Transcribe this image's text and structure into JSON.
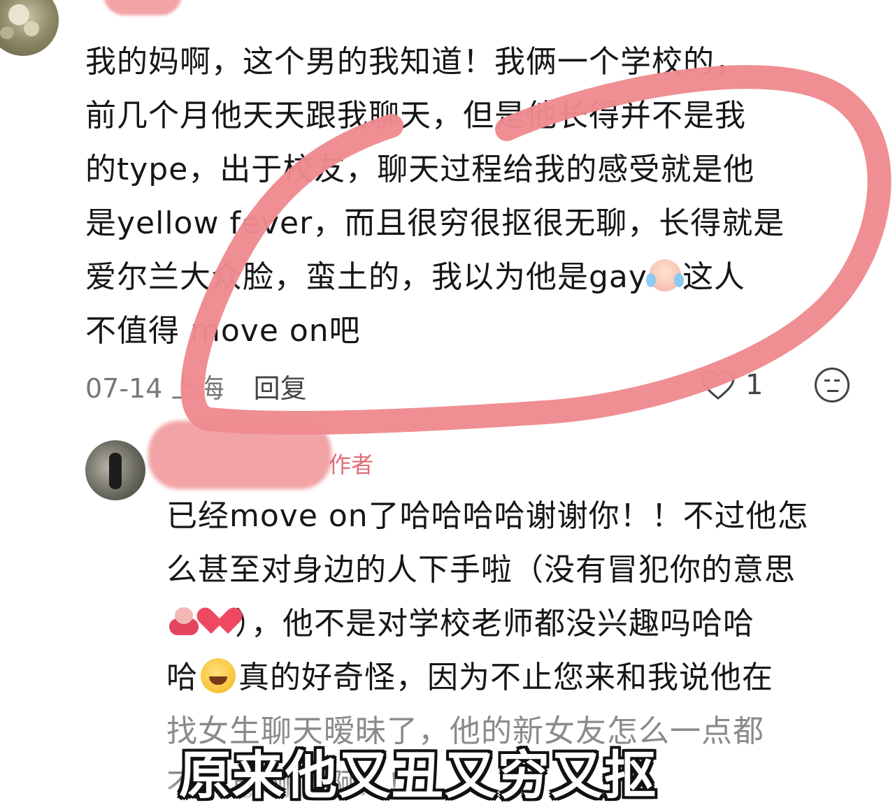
{
  "comment1": {
    "lines": [
      "我的妈啊，这个男的我知道！我俩一个学校的，",
      "前几个月他天天跟我聊天，但是他长得并不是我",
      "的type，出于校友，聊天过程给我的感受就是他",
      "是yellow fever，而且很穷很抠很无聊，长得就是",
      "爱尔兰大众脸，蛮土的，我以为他是gay",
      "这人",
      "不值得",
      "move on吧"
    ],
    "date": "07-14",
    "location": "上海",
    "reply_label": "回复",
    "like_count": "1"
  },
  "comment2": {
    "author_tag": "作者",
    "lines": [
      "已经move on了哈哈哈哈谢谢你！！不过他怎",
      "么甚至对身边的人下手啦（没有冒犯你的意思",
      "），他不是对学校老师都没兴趣吗哈哈",
      "哈",
      "真的好奇怪，因为不止您来和我说他在",
      "找女生聊天暧昧了，他的新女友怎么一点都",
      "不介意啊啊啊！！"
    ]
  },
  "caption": "原来他又丑又穷又抠",
  "colors": {
    "highlight_ellipse": "#ee8b8f",
    "name_redaction": "#f2a3a6",
    "author_tag": "#e06c74"
  },
  "icons": [
    "heart-outline-icon",
    "neutral-face-icon",
    "crying-laugh-emoji",
    "pig-emoji",
    "heart-emoji",
    "rofl-emoji"
  ]
}
